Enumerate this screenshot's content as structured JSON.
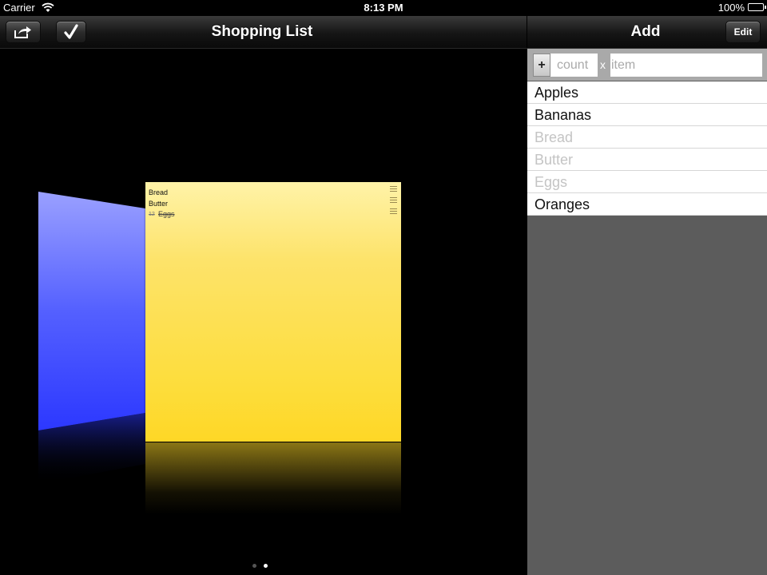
{
  "status": {
    "carrier": "Carrier",
    "time": "8:13 PM",
    "battery": "100%"
  },
  "nav": {
    "title": "Shopping List",
    "add_title": "Add",
    "edit_label": "Edit"
  },
  "note": {
    "lines": [
      "Bread",
      "Butter",
      "Eggs"
    ],
    "eggs_qty": "12",
    "color": "#fddd3a",
    "back_card_color": "#3a4cff"
  },
  "pager": {
    "pages": 2,
    "current": 2
  },
  "entry": {
    "plus_label": "+",
    "count_placeholder": "count",
    "separator": "x",
    "item_placeholder": "item"
  },
  "items": [
    {
      "name": "Apples",
      "done": false
    },
    {
      "name": "Bananas",
      "done": false
    },
    {
      "name": "Bread",
      "done": true
    },
    {
      "name": "Butter",
      "done": true
    },
    {
      "name": "Eggs",
      "done": true
    },
    {
      "name": "Oranges",
      "done": false
    }
  ]
}
